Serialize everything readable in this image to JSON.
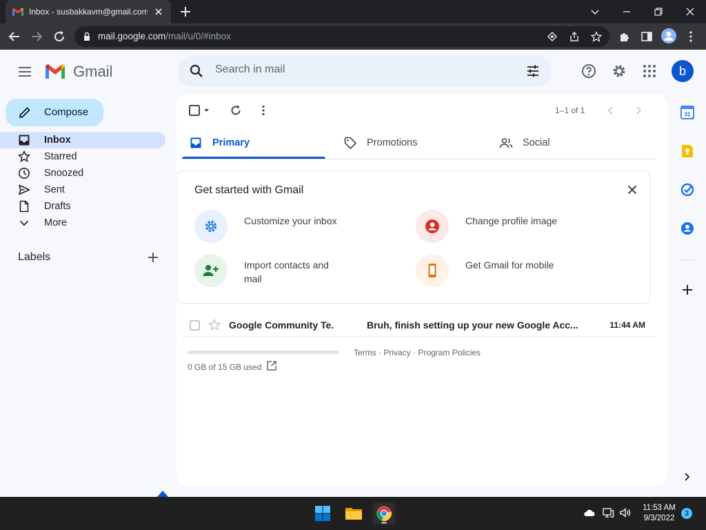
{
  "browser": {
    "tab_title": "Inbox - susbakkavm@gmail.com",
    "url_host": "mail.google.com",
    "url_path": "/mail/u/0/#inbox"
  },
  "app": {
    "name": "Gmail"
  },
  "search": {
    "placeholder": "Search in mail"
  },
  "account": {
    "avatar_letter": "b"
  },
  "sidebar": {
    "compose_label": "Compose",
    "items": [
      {
        "label": "Inbox",
        "icon": "inbox-icon",
        "active": true
      },
      {
        "label": "Starred",
        "icon": "star-icon"
      },
      {
        "label": "Snoozed",
        "icon": "clock-icon"
      },
      {
        "label": "Sent",
        "icon": "send-icon"
      },
      {
        "label": "Drafts",
        "icon": "draft-icon"
      },
      {
        "label": "More",
        "icon": "chevron-down-icon"
      }
    ],
    "labels_title": "Labels"
  },
  "toolbar": {
    "pager": "1–1 of 1"
  },
  "tabs": [
    {
      "label": "Primary",
      "icon": "inbox-tab-icon",
      "active": true
    },
    {
      "label": "Promotions",
      "icon": "tag-icon"
    },
    {
      "label": "Social",
      "icon": "people-icon"
    }
  ],
  "get_started": {
    "title": "Get started with Gmail",
    "items": [
      {
        "text": "Customize your inbox",
        "icon": "gear-icon"
      },
      {
        "text": "Change profile image",
        "icon": "account-circle-icon"
      },
      {
        "text": "Import contacts and mail",
        "icon": "person-add-icon"
      },
      {
        "text": "Get Gmail for mobile",
        "icon": "phone-icon"
      }
    ]
  },
  "emails": [
    {
      "sender": "Google Community Te.",
      "subject": "Bruh, finish setting up your new Google Acc...",
      "time": "11:44 AM"
    }
  ],
  "storage": {
    "text": "0 GB of 15 GB used",
    "used_fraction": 0
  },
  "footer": {
    "links": "Terms · Privacy · Program Policies"
  },
  "taskbar": {
    "time": "11:53 AM",
    "date": "9/3/2022",
    "notifications": "3"
  },
  "colors": {
    "accent": "#0b57d0",
    "compose_bg": "#c2e7ff",
    "active_nav": "#d3e3fd",
    "page_bg": "#f6f8fc"
  }
}
